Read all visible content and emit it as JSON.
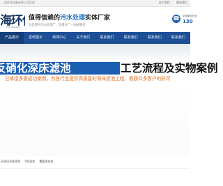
{
  "topbar": {
    "company": "...海环保设备有限公司官网",
    "links": [
      "关于我们",
      "联系我们"
    ]
  },
  "header": {
    "logo_text": "海环保",
    "logo_sub": "HAIHUANBAO",
    "slogan_prefix": "值得信赖的",
    "slogan_highlight": "污水处理",
    "slogan_suffix": "实体厂家",
    "slogan_sub": "为您提供污水处理厂，改善水厂一站式服务",
    "phone_label": "全国服务热线",
    "phone_number": "130"
  },
  "nav": {
    "items": [
      "产品展示",
      "案例展示",
      "新闻中心",
      "关于我们",
      "联系我们",
      "联系我们",
      "联系我们",
      "联系我们"
    ]
  },
  "banner": {
    "title_blue": "反硝化深床滤池",
    "title_black": "工艺流程及实物案例",
    "subtitle": "已承接多家成功案例，为各行业提供高质量的深床滤池工程，收获众多客户的好评"
  },
  "breadcrumb": {
    "items": [
      "反硝化深床滤池",
      "V型滤池",
      "重量流滤池"
    ]
  },
  "colors": {
    "nav_bg": "#1c4f96",
    "title_blue_bg": "#1c5fb1",
    "subtitle_orange": "#e06b1c",
    "accent_blue": "#1f6fc3"
  },
  "icons": {
    "phone": "phone-icon"
  }
}
